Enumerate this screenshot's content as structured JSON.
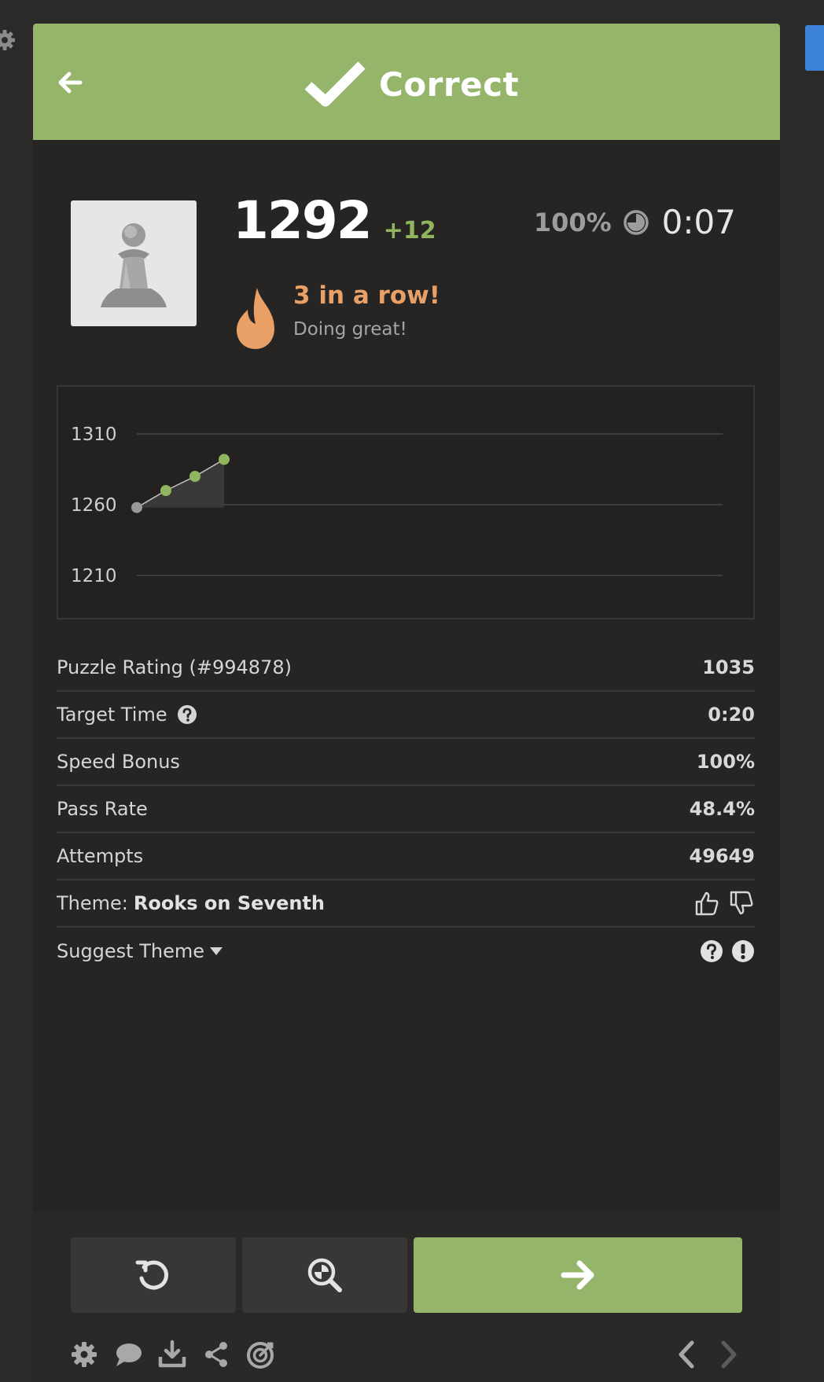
{
  "banner": {
    "title": "Correct",
    "back_icon": "arrow-left-icon",
    "check_icon": "checkmark-icon",
    "color": "#95b56a"
  },
  "rating": {
    "value": "1292",
    "delta": "+12",
    "speed": "100%",
    "time": "0:07",
    "delta_color": "#8fb55e"
  },
  "streak": {
    "title": "3 in a row!",
    "subtitle": "Doing great!",
    "color": "#e8a066"
  },
  "chart_data": {
    "type": "line",
    "y_ticks": [
      "1310",
      "1260",
      "1210"
    ],
    "ylim": [
      1210,
      1310
    ],
    "x": [
      1,
      2,
      3,
      4
    ],
    "values": [
      1258,
      1270,
      1280,
      1292
    ],
    "grid": true,
    "colors": {
      "start_point": "#9a9998",
      "points": "#8fb55e",
      "fill": "#3a3937",
      "line": "#c7c6c4"
    }
  },
  "stats": [
    {
      "label": "Puzzle Rating (#994878)",
      "value": "1035"
    },
    {
      "label": "Target Time",
      "value": "0:20",
      "icon": "question-circle-icon"
    },
    {
      "label": "Speed Bonus",
      "value": "100%"
    },
    {
      "label": "Pass Rate",
      "value": "48.4%"
    },
    {
      "label": "Attempts",
      "value": "49649"
    }
  ],
  "theme": {
    "label": "Theme:",
    "name": "Rooks on Seventh",
    "icons": [
      "thumbs-up-icon",
      "thumbs-down-icon"
    ]
  },
  "suggest": {
    "label": "Suggest Theme",
    "icons": [
      "question-circle-icon",
      "exclamation-circle-icon"
    ]
  },
  "actions": {
    "retry_icon": "retry-icon",
    "analyze_icon": "analysis-icon",
    "next_icon": "arrow-right-icon",
    "next_color": "#95b56a"
  },
  "toolbar": {
    "icons": [
      "gear-icon",
      "chat-icon",
      "download-icon",
      "share-icon",
      "target-icon"
    ],
    "nav": [
      "chevron-left-icon",
      "chevron-right-icon"
    ]
  }
}
